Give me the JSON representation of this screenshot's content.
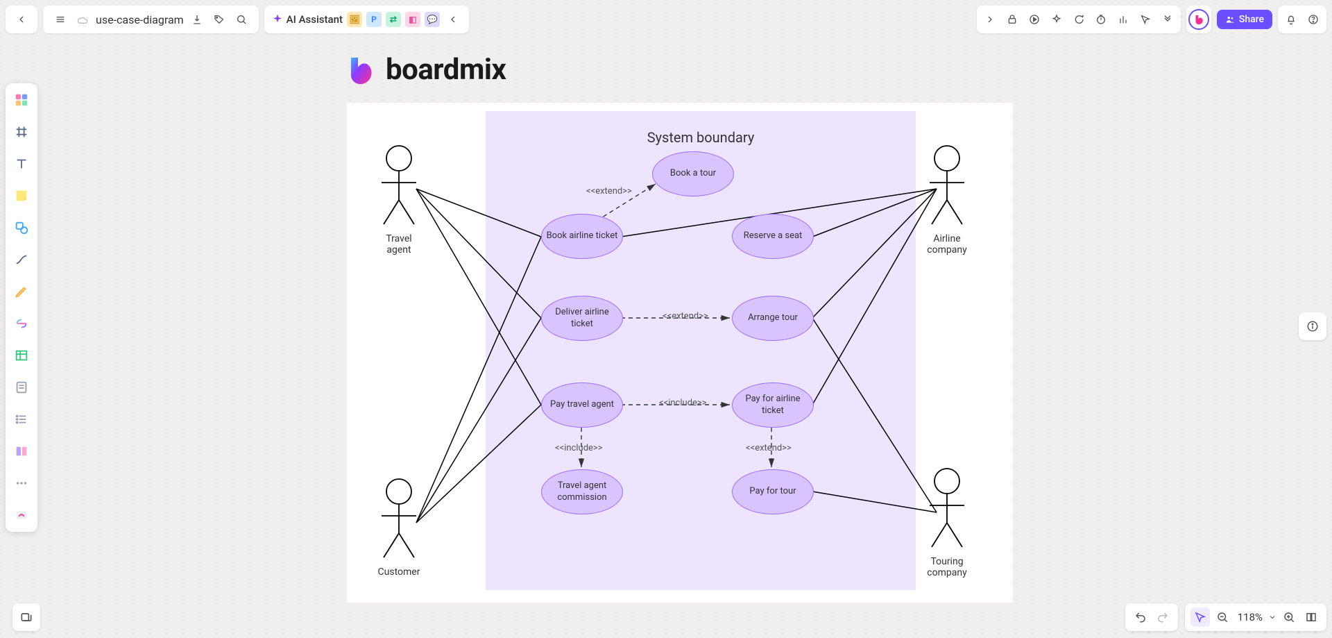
{
  "document": {
    "title": "use-case-diagram"
  },
  "ai": {
    "label": "AI Assistant"
  },
  "share": {
    "label": "Share"
  },
  "zoom": {
    "value": "118%"
  },
  "logo": {
    "text": "boardmix"
  },
  "diagram": {
    "boundary": "System boundary",
    "actors": {
      "travel_agent": "Travel agent",
      "customer": "Customer",
      "airline": "Airline company",
      "touring": "Touring company"
    },
    "usecases": {
      "book_tour": "Book a tour",
      "book_ticket": "Book airline ticket",
      "reserve_seat": "Reserve a seat",
      "deliver_ticket": "Deliver airline ticket",
      "arrange_tour": "Arrange tour",
      "pay_agent": "Pay travel agent",
      "pay_ticket": "Pay for airline ticket",
      "agent_commission": "Travel agent commission",
      "pay_tour": "Pay for tour"
    },
    "relations": {
      "extend": "<<extend>>",
      "include": "<<include>>"
    }
  }
}
